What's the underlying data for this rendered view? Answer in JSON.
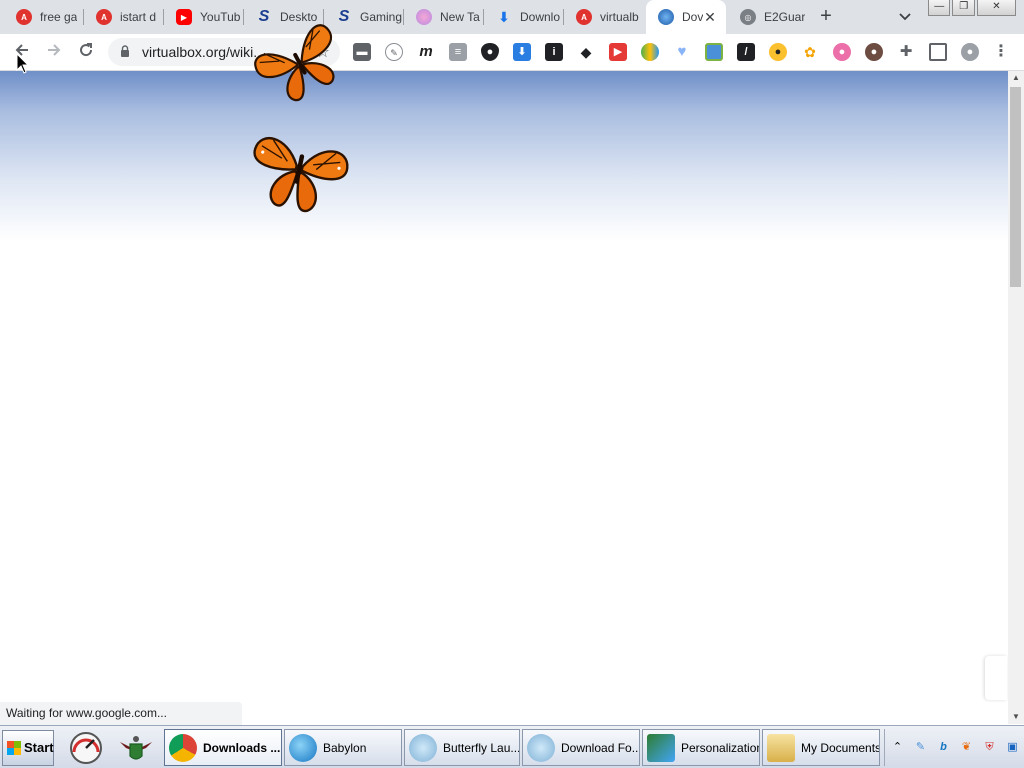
{
  "browser": {
    "tabs": [
      {
        "title": "free ga",
        "icon": "ask-icon",
        "active": false
      },
      {
        "title": "istart d",
        "icon": "ask-icon",
        "active": false
      },
      {
        "title": "YouTub",
        "icon": "youtube-icon",
        "active": false
      },
      {
        "title": "Deskto",
        "icon": "s-brand-icon",
        "active": false
      },
      {
        "title": "Gaming",
        "icon": "s-brand-icon",
        "active": false
      },
      {
        "title": "New Ta",
        "icon": "newtab-icon",
        "active": false
      },
      {
        "title": "Downlo",
        "icon": "download-icon",
        "active": false
      },
      {
        "title": "virtualb",
        "icon": "ask-icon",
        "active": false
      },
      {
        "title": "Dov",
        "icon": "globe-icon",
        "active": true
      },
      {
        "title": "E2Guar",
        "icon": "globe-icon",
        "active": false
      }
    ],
    "new_tab_label": "+",
    "tab_list_label": "⌄",
    "window_buttons": {
      "minimize": "—",
      "restore": "❐",
      "close": "✕"
    },
    "address": "virtualbox.org/wiki...",
    "status_text": "Waiting for www.google.com...",
    "extensions": [
      "folder-icon",
      "compass-icon",
      "m-icon",
      "stripes-icon",
      "shield-icon",
      "download-arrow-icon",
      "info-icon",
      "graduation-icon",
      "video-icon",
      "cloud-icon",
      "heart-icon",
      "screen-icon",
      "slash-icon",
      "ninja-icon",
      "palette-icon",
      "avatar-bear-icon",
      "bear-icon",
      "puzzle-icon",
      "sidepanel-icon",
      "profile-icon",
      "menu-icon"
    ]
  },
  "taskbar": {
    "start_label": "Start",
    "items": [
      {
        "label": "Downloads ...",
        "active": true
      },
      {
        "label": "Babylon",
        "active": false
      },
      {
        "label": "Butterfly Lau...",
        "active": false
      },
      {
        "label": "Download Fo...",
        "active": false
      },
      {
        "label": "Personalization",
        "active": false
      },
      {
        "label": "My Documents",
        "active": false
      }
    ],
    "tray_expand": "⌃"
  }
}
